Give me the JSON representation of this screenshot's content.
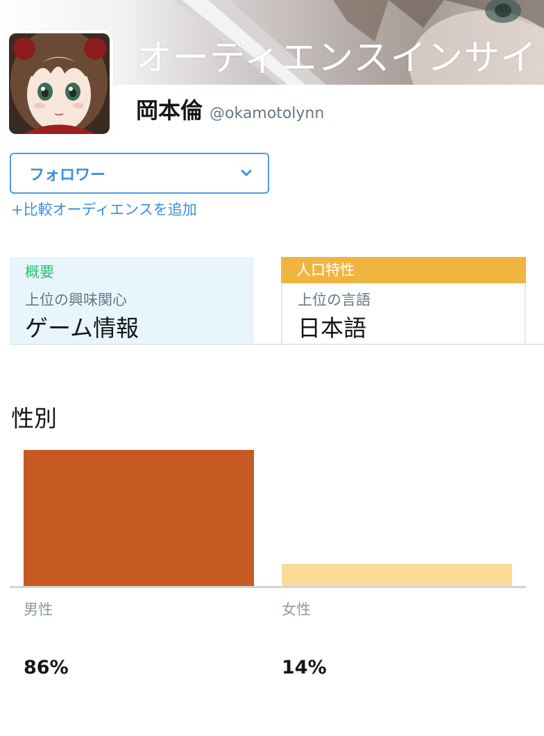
{
  "header": {
    "title": "オーディエンスインサイ"
  },
  "profile": {
    "display_name": "岡本倫",
    "handle": "@okamotolynn"
  },
  "audience_select": {
    "selected": "フォロワー",
    "add_compare": "+比較オーディエンスを追加"
  },
  "cards": {
    "overview": {
      "tab_label": "概要",
      "sub_label": "上位の興味関心",
      "value": "ゲーム情報"
    },
    "demographics": {
      "tab_label": "人口特性",
      "sub_label": "上位の言語",
      "value": "日本語"
    }
  },
  "gender": {
    "title": "性別",
    "male_label": "男性",
    "male_pct": "86%",
    "female_label": "女性",
    "female_pct": "14%"
  },
  "chart_data": {
    "type": "bar",
    "categories": [
      "男性",
      "女性"
    ],
    "values": [
      86,
      14
    ],
    "title": "性別",
    "xlabel": "",
    "ylabel": "",
    "colors": [
      "#c75a22",
      "#fadb98"
    ]
  },
  "colors": {
    "accent_blue": "#3a8fd9",
    "overview_green": "#2fbf71",
    "demographics_tab": "#f0b541",
    "male_bar": "#c75a22",
    "female_bar": "#fadb98"
  },
  "icons": {
    "dropdown": "chevron-down-icon"
  }
}
